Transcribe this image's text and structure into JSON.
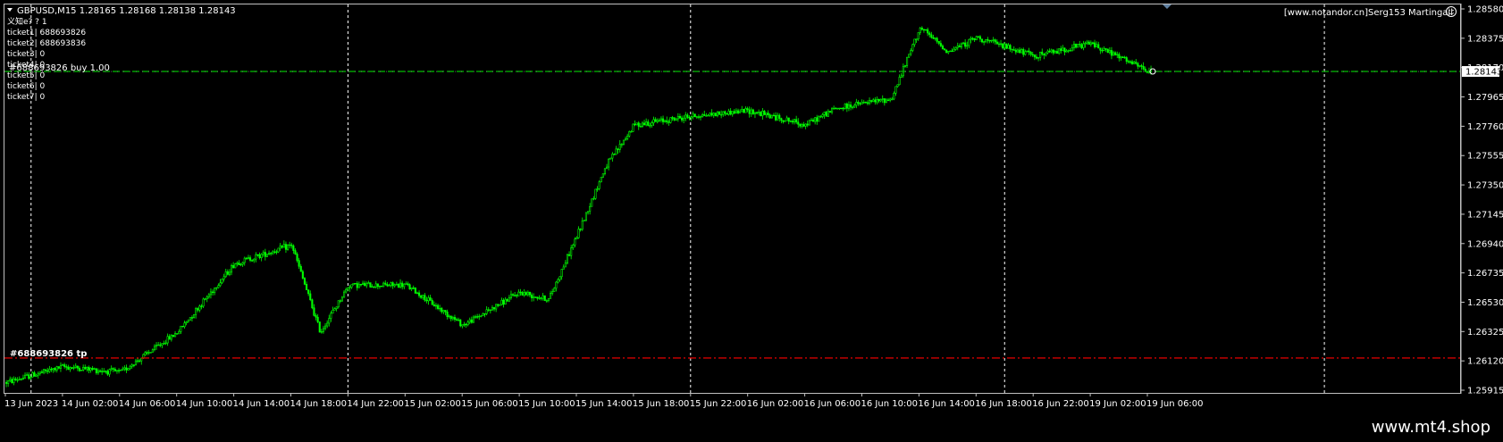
{
  "header": {
    "symbol_line": "GBPUSD,M15  1.28165 1.28168 1.28138 1.28143",
    "brand_top_right": "[www.notandor.cn]Serg153 Martingail"
  },
  "info_lines": [
    "义知e?  ? 1",
    "ticket1| 688693826",
    "ticket2| 688693836",
    "ticket3| 0",
    "ticket4| 0",
    "ticket5| 0",
    "ticket6| 0",
    "ticket7| 0"
  ],
  "order_labels": {
    "buy": "#688693826 buy 1.00",
    "tp": "#688693826 tp"
  },
  "current_price_label": "1.28143",
  "footer": {
    "site": "www.mt4.shop"
  },
  "colors": {
    "background": "#000000",
    "candles": "#00ff00",
    "grid": "#ffffff",
    "order_line": "#00c000",
    "tp_line": "#ff0000",
    "text": "#ffffff"
  },
  "chart_data": {
    "type": "candlestick",
    "symbol": "GBPUSD",
    "timeframe": "M15",
    "ylim": [
      1.25915,
      1.2858
    ],
    "y_ticks": [
      "1.28580",
      "1.28375",
      "1.28170",
      "1.27965",
      "1.27760",
      "1.27555",
      "1.27350",
      "1.27145",
      "1.26940",
      "1.26735",
      "1.26530",
      "1.26325",
      "1.26120",
      "1.25915"
    ],
    "x_ticks": [
      "13 Jun 2023",
      "14 Jun 02:00",
      "14 Jun 06:00",
      "14 Jun 10:00",
      "14 Jun 14:00",
      "14 Jun 18:00",
      "14 Jun 22:00",
      "15 Jun 02:00",
      "15 Jun 06:00",
      "15 Jun 10:00",
      "15 Jun 14:00",
      "15 Jun 18:00",
      "15 Jun 22:00",
      "16 Jun 02:00",
      "16 Jun 06:00",
      "16 Jun 10:00",
      "16 Jun 14:00",
      "16 Jun 18:00",
      "16 Jun 22:00",
      "19 Jun 02:00",
      "19 Jun 06:00"
    ],
    "period_separators": [
      "14 Jun",
      "15 Jun",
      "16 Jun",
      "19 Jun",
      "20 Jun"
    ],
    "buy_order_price": 1.28143,
    "take_profit_price": 1.2614,
    "current_price": 1.28143,
    "price_path": [
      {
        "t": "13 Jun 2023",
        "price": 1.2597
      },
      {
        "t": "14 Jun 02:00",
        "price": 1.2608
      },
      {
        "t": "14 Jun 06:00",
        "price": 1.2604
      },
      {
        "t": "14 Jun 10:00",
        "price": 1.2632
      },
      {
        "t": "14 Jun 14:00",
        "price": 1.268
      },
      {
        "t": "14 Jun 18:00",
        "price": 1.2693
      },
      {
        "t": "14 Jun 20:00",
        "price": 1.2632
      },
      {
        "t": "14 Jun 22:00",
        "price": 1.2665
      },
      {
        "t": "15 Jun 02:00",
        "price": 1.2665
      },
      {
        "t": "15 Jun 06:00",
        "price": 1.2637
      },
      {
        "t": "15 Jun 10:00",
        "price": 1.266
      },
      {
        "t": "15 Jun 12:00",
        "price": 1.2655
      },
      {
        "t": "15 Jun 14:00",
        "price": 1.27
      },
      {
        "t": "15 Jun 16:00",
        "price": 1.2748
      },
      {
        "t": "15 Jun 18:00",
        "price": 1.2777
      },
      {
        "t": "15 Jun 22:00",
        "price": 1.2783
      },
      {
        "t": "16 Jun 02:00",
        "price": 1.2787
      },
      {
        "t": "16 Jun 06:00",
        "price": 1.2777
      },
      {
        "t": "16 Jun 08:00",
        "price": 1.2788
      },
      {
        "t": "16 Jun 10:00",
        "price": 1.2792
      },
      {
        "t": "16 Jun 12:00",
        "price": 1.2795
      },
      {
        "t": "16 Jun 14:00",
        "price": 1.2845
      },
      {
        "t": "16 Jun 16:00",
        "price": 1.2828
      },
      {
        "t": "16 Jun 18:00",
        "price": 1.2838
      },
      {
        "t": "16 Jun 22:00",
        "price": 1.2825
      },
      {
        "t": "19 Jun 02:00",
        "price": 1.2834
      },
      {
        "t": "19 Jun 06:00",
        "price": 1.28143
      }
    ]
  }
}
